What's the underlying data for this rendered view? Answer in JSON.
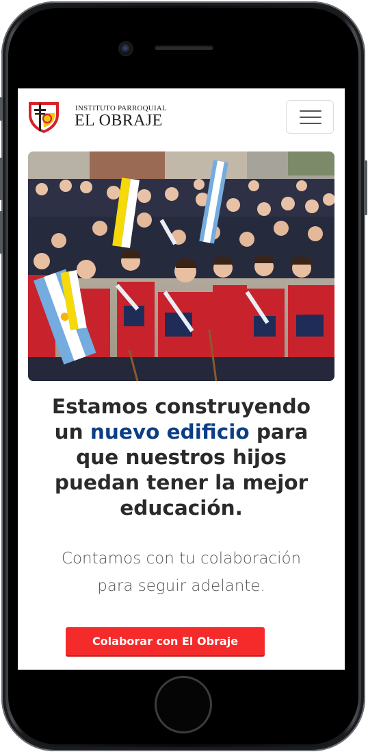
{
  "brand": {
    "top_line": "INSTITUTO PARROQUIAL",
    "name": "EL OBRAJE"
  },
  "nav": {
    "menu_icon": "hamburger-menu-icon"
  },
  "hero": {
    "image_subject": "school-children-parade-with-argentine-and-vatican-flags"
  },
  "headline": {
    "part1": "Estamos construyendo un ",
    "accent": "nuevo edificio",
    "part2": " para que nuestros hijos puedan tener la mejor educación."
  },
  "subtext": {
    "line1": "Contamos con tu colaboración",
    "line2": "para seguir adelante."
  },
  "cta": {
    "label": "Colaborar con El Obraje"
  },
  "colors": {
    "accent_blue": "#0c3e86",
    "cta_red": "#f52b2b",
    "logo_red": "#d9202a",
    "logo_yellow": "#f3c511"
  }
}
